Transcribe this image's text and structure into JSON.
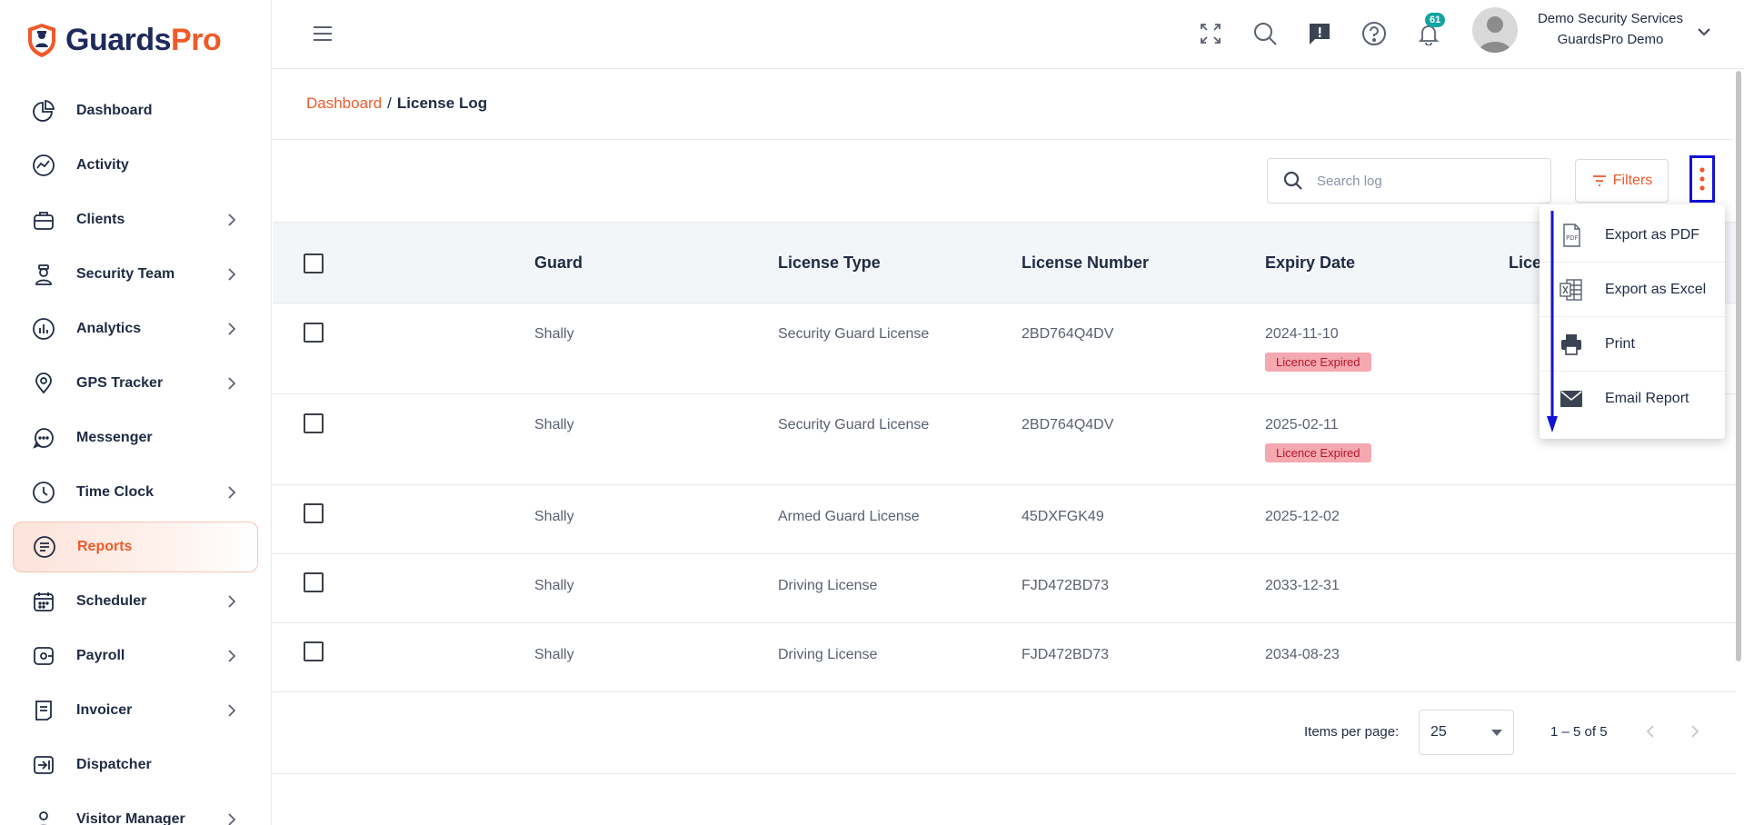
{
  "brand": {
    "part1": "Guards",
    "part2": "Pro",
    "color_accent": "#ef5a28",
    "color_primary": "#1f2a5c"
  },
  "sidebar": {
    "items": [
      {
        "label": "Dashboard",
        "icon": "dashboard-icon",
        "has_chevron": false
      },
      {
        "label": "Activity",
        "icon": "activity-icon",
        "has_chevron": false
      },
      {
        "label": "Clients",
        "icon": "clients-icon",
        "has_chevron": true
      },
      {
        "label": "Security Team",
        "icon": "security-team-icon",
        "has_chevron": true
      },
      {
        "label": "Analytics",
        "icon": "analytics-icon",
        "has_chevron": true
      },
      {
        "label": "GPS Tracker",
        "icon": "gps-tracker-icon",
        "has_chevron": true
      },
      {
        "label": "Messenger",
        "icon": "messenger-icon",
        "has_chevron": false
      },
      {
        "label": "Time Clock",
        "icon": "time-clock-icon",
        "has_chevron": true
      },
      {
        "label": "Reports",
        "icon": "reports-icon",
        "has_chevron": false,
        "active": true
      },
      {
        "label": "Scheduler",
        "icon": "scheduler-icon",
        "has_chevron": true
      },
      {
        "label": "Payroll",
        "icon": "payroll-icon",
        "has_chevron": true
      },
      {
        "label": "Invoicer",
        "icon": "invoicer-icon",
        "has_chevron": true
      },
      {
        "label": "Dispatcher",
        "icon": "dispatcher-icon",
        "has_chevron": false
      },
      {
        "label": "Visitor Manager",
        "icon": "visitor-manager-icon",
        "has_chevron": true
      }
    ]
  },
  "header": {
    "notification_count": "61",
    "user": {
      "company": "Demo Security Services",
      "name": "GuardsPro Demo"
    }
  },
  "breadcrumb": {
    "root": "Dashboard",
    "separator": "/",
    "current": "License Log"
  },
  "toolbar": {
    "search_placeholder": "Search log",
    "filters_label": "Filters"
  },
  "table": {
    "columns": [
      "Guard",
      "License Type",
      "License Number",
      "Expiry Date",
      "Lice"
    ],
    "rows": [
      {
        "guard": "Shally",
        "license_type": "Security Guard License",
        "license_number": "2BD764Q4DV",
        "expiry_date": "2024-11-10",
        "status": "Licence Expired"
      },
      {
        "guard": "Shally",
        "license_type": "Security Guard License",
        "license_number": "2BD764Q4DV",
        "expiry_date": "2025-02-11",
        "status": "Licence Expired"
      },
      {
        "guard": "Shally",
        "license_type": "Armed Guard License",
        "license_number": "45DXFGK49",
        "expiry_date": "2025-12-02",
        "status": ""
      },
      {
        "guard": "Shally",
        "license_type": "Driving License",
        "license_number": "FJD472BD73",
        "expiry_date": "2033-12-31",
        "status": ""
      },
      {
        "guard": "Shally",
        "license_type": "Driving License",
        "license_number": "FJD472BD73",
        "expiry_date": "2034-08-23",
        "status": ""
      }
    ]
  },
  "pagination": {
    "items_per_page_label": "Items per page:",
    "items_per_page": "25",
    "range": "1 – 5 of 5"
  },
  "export_menu": {
    "items": [
      {
        "label": "Export as PDF",
        "icon": "pdf-icon"
      },
      {
        "label": "Export as Excel",
        "icon": "excel-icon"
      },
      {
        "label": "Print",
        "icon": "print-icon"
      },
      {
        "label": "Email Report",
        "icon": "email-icon"
      }
    ]
  }
}
